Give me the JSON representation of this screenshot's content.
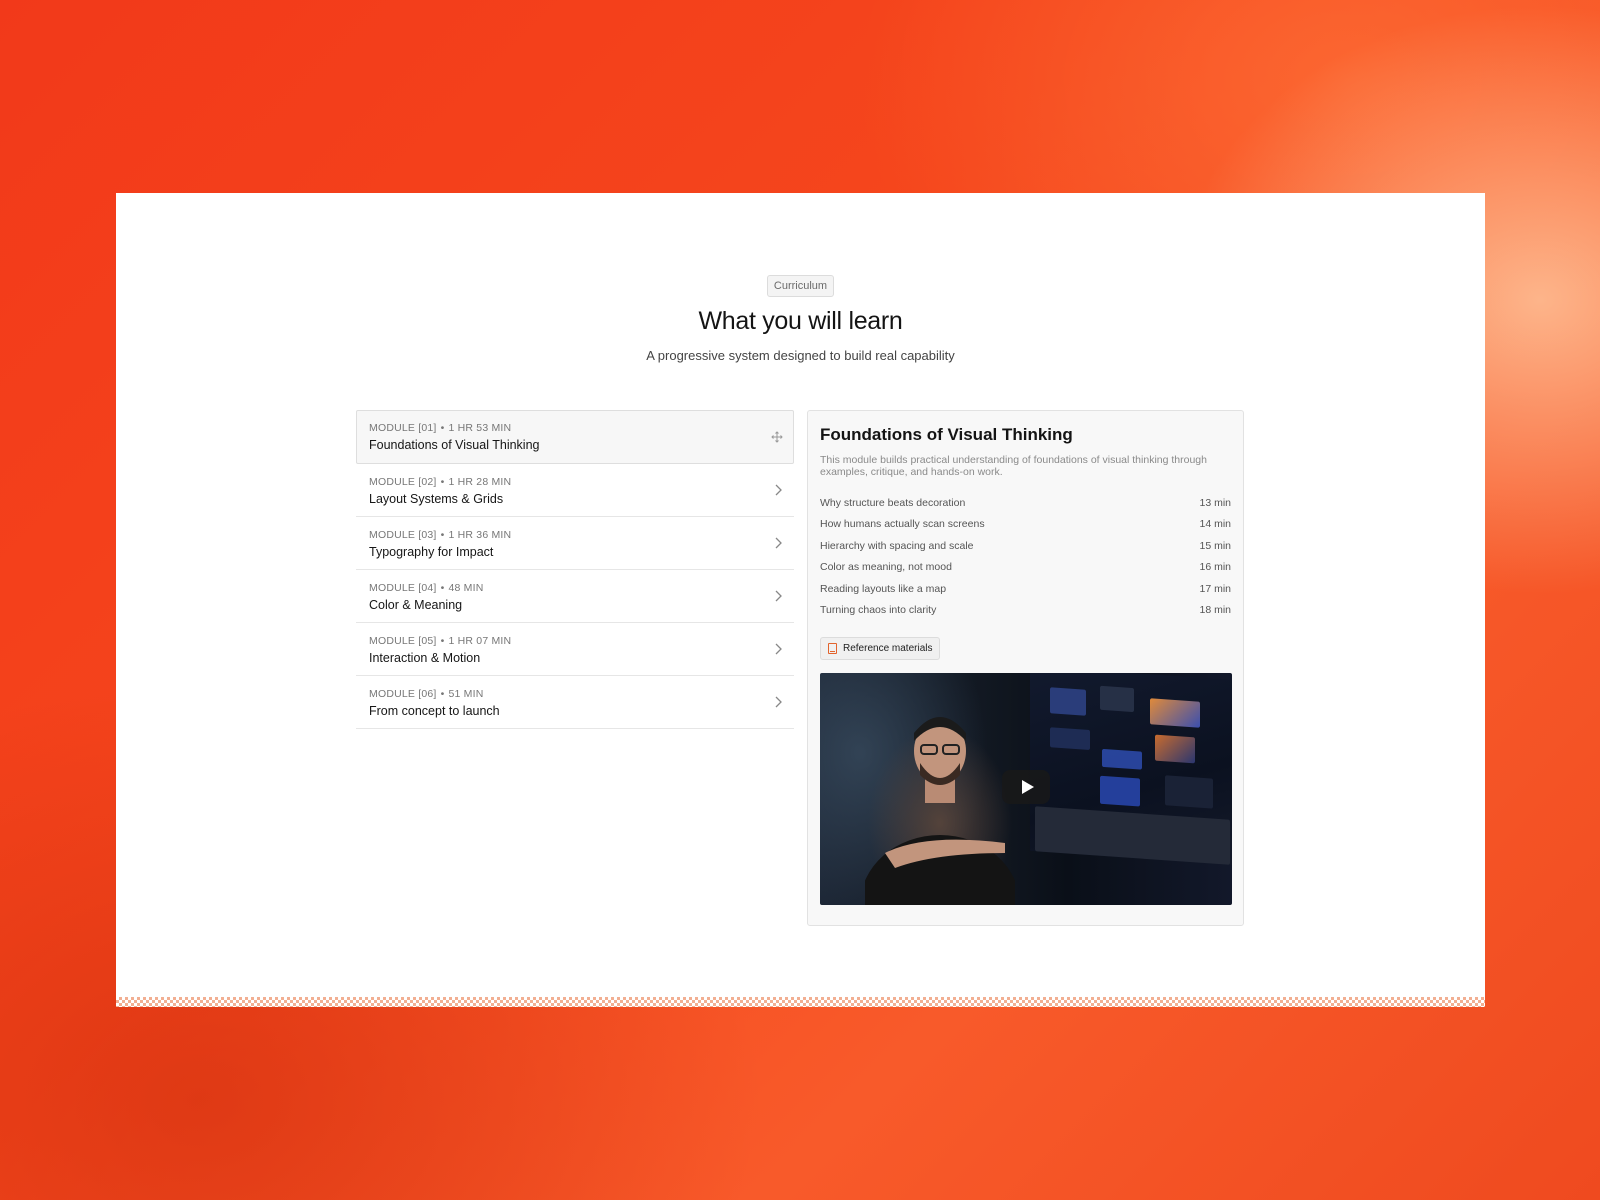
{
  "header": {
    "badge": "Curriculum",
    "title": "What you will learn",
    "subtitle": "A progressive system designed to build real capability"
  },
  "modules": [
    {
      "label": "MODULE [01]",
      "duration": "1 HR 53 MIN",
      "name": "Foundations of Visual Thinking",
      "active": true
    },
    {
      "label": "MODULE [02]",
      "duration": "1 HR 28 MIN",
      "name": "Layout Systems & Grids"
    },
    {
      "label": "MODULE [03]",
      "duration": "1 HR 36 MIN",
      "name": "Typography for Impact"
    },
    {
      "label": "MODULE [04]",
      "duration": "48 MIN",
      "name": "Color & Meaning"
    },
    {
      "label": "MODULE [05]",
      "duration": "1 HR 07 MIN",
      "name": "Interaction & Motion"
    },
    {
      "label": "MODULE [06]",
      "duration": "51 MIN",
      "name": "From concept to launch"
    }
  ],
  "detail": {
    "title": "Foundations of Visual Thinking",
    "description": "This module builds practical understanding of foundations of visual thinking through examples, critique, and hands-on work.",
    "lessons": [
      {
        "title": "Why structure beats decoration",
        "duration": "13 min"
      },
      {
        "title": "How humans actually scan screens",
        "duration": "14 min"
      },
      {
        "title": "Hierarchy with spacing and scale",
        "duration": "15 min"
      },
      {
        "title": "Color as meaning, not mood",
        "duration": "16 min"
      },
      {
        "title": "Reading layouts like a map",
        "duration": "17 min"
      },
      {
        "title": "Turning chaos into clarity",
        "duration": "18 min"
      }
    ],
    "reference_label": "Reference materials",
    "reference_icon": "book-icon",
    "video_icon": "play-icon"
  },
  "colors": {
    "background": "#f5461c",
    "accent": "#e2632c",
    "text": "#141414"
  }
}
